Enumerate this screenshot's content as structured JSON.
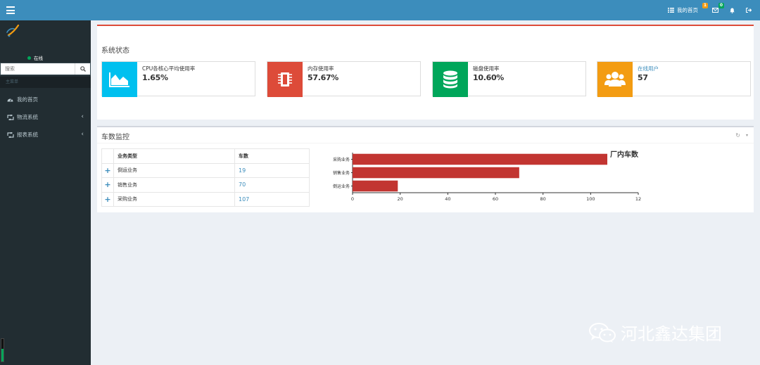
{
  "topbar": {
    "home_label": "我的首页",
    "home_badge": "1",
    "mail_badge": "0"
  },
  "sidebar": {
    "status": "在线",
    "search_placeholder": "搜索",
    "menu_header": "主菜单",
    "items": [
      {
        "label": "我的首页",
        "icon": "dashboard-icon",
        "expandable": false
      },
      {
        "label": "物流系统",
        "icon": "retweet-icon",
        "expandable": true
      },
      {
        "label": "报表系统",
        "icon": "retweet-icon",
        "expandable": true
      }
    ],
    "gauge_level": 0.55
  },
  "system_status": {
    "title": "系统状态",
    "cards": [
      {
        "label": "CPU各核心平均使用率",
        "value": "1.65%",
        "color": "#00c0ef",
        "icon": "area-chart-icon"
      },
      {
        "label": "内存使用率",
        "value": "57.67%",
        "color": "#dd4b39",
        "icon": "memory-chip-icon"
      },
      {
        "label": "磁盘使用率",
        "value": "10.60%",
        "color": "#00a65a",
        "icon": "database-icon"
      },
      {
        "label": "在线用户",
        "value": "57",
        "color": "#f39c12",
        "icon": "users-icon"
      }
    ]
  },
  "vehicle_monitor": {
    "title": "车数监控",
    "table": {
      "headers": [
        "业务类型",
        "车数"
      ],
      "rows": [
        {
          "type": "倒运业务",
          "count": "19"
        },
        {
          "type": "销售业务",
          "count": "70"
        },
        {
          "type": "采购业务",
          "count": "107"
        }
      ]
    }
  },
  "chart_data": {
    "type": "bar",
    "orientation": "horizontal",
    "title": "厂内车数",
    "categories": [
      "采购业务",
      "销售业务",
      "倒运业务"
    ],
    "values": [
      107,
      70,
      19
    ],
    "xlim": [
      0,
      120
    ],
    "xticks": [
      "0",
      "20",
      "40",
      "60",
      "80",
      "100",
      "12"
    ],
    "color": "#c23531",
    "grid": false
  },
  "watermark": "河北鑫达集团"
}
